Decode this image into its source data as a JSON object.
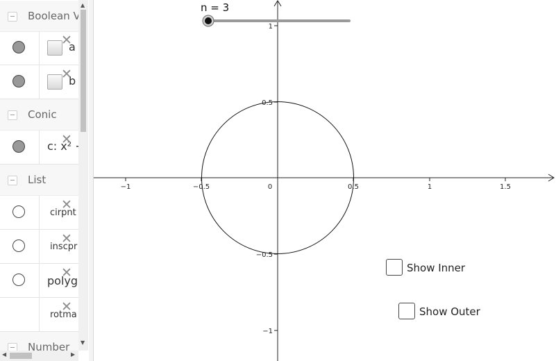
{
  "algebra": {
    "groups": [
      {
        "label": "Boolean V",
        "items": [
          {
            "dot": "filled",
            "checkbox": true,
            "text": "a"
          },
          {
            "dot": "filled",
            "checkbox": true,
            "text": "b"
          }
        ]
      },
      {
        "label": "Conic",
        "items": [
          {
            "dot": "filled",
            "checkbox": false,
            "text": "c: x² +"
          }
        ]
      },
      {
        "label": "List",
        "items": [
          {
            "dot": "empty",
            "checkbox": false,
            "text": "cirpnt"
          },
          {
            "dot": "empty",
            "checkbox": false,
            "text": "inscpr"
          },
          {
            "dot": "empty",
            "checkbox": false,
            "text": "polyg"
          },
          {
            "dot": "none",
            "checkbox": false,
            "text": "rotma"
          }
        ]
      },
      {
        "label": "Number",
        "items": []
      }
    ],
    "delete_icon": "close-icon"
  },
  "slider": {
    "label": "n = 3",
    "value": 3
  },
  "checkboxes": {
    "show_inner": "Show Inner",
    "show_outer": "Show Outer"
  },
  "axes": {
    "x_ticks": [
      "−1",
      "−0.5",
      "0",
      "0.5",
      "1",
      "1.5"
    ],
    "y_ticks": [
      "1",
      "0.5",
      "−0.5",
      "−1"
    ]
  },
  "circle": {
    "center": [
      0,
      0
    ],
    "radius": 0.5
  },
  "colors": {
    "dot_filled": "#999999",
    "panel_header": "#f7f7f7",
    "slider_track": "#9a9a9a"
  }
}
